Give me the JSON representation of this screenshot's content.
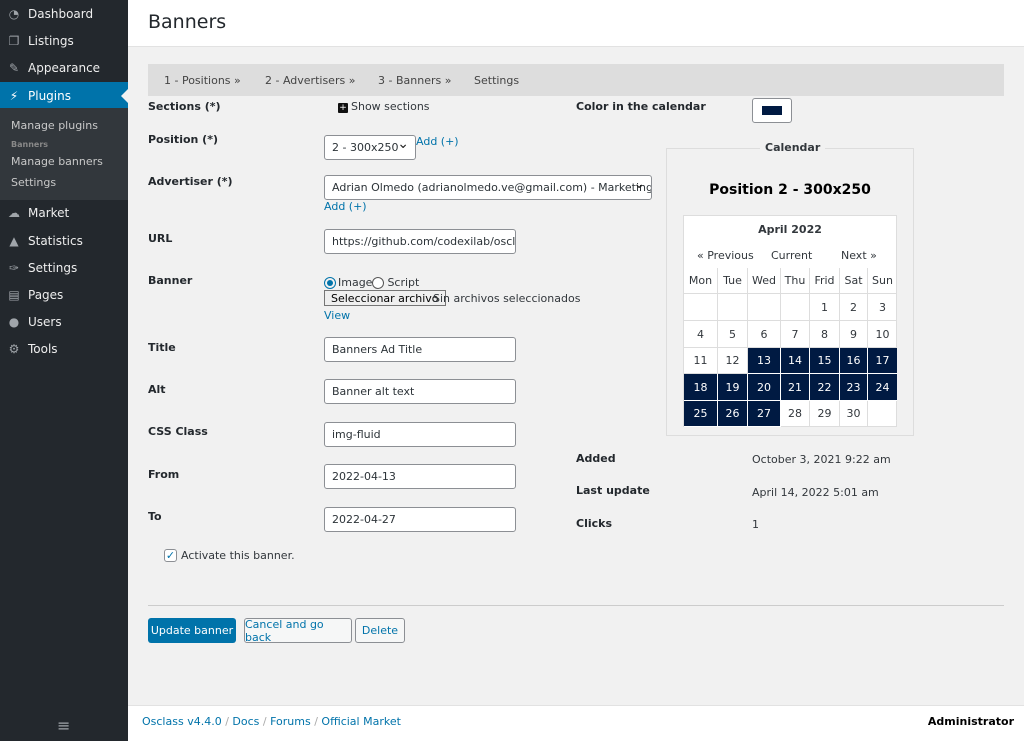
{
  "sidebar": {
    "items": [
      {
        "label": "Dashboard",
        "icon": "dashboard-icon",
        "glyph": "◔"
      },
      {
        "label": "Listings",
        "icon": "listings-icon",
        "glyph": "❐"
      },
      {
        "label": "Appearance",
        "icon": "brush-icon",
        "glyph": "✎"
      },
      {
        "label": "Plugins",
        "icon": "plug-icon",
        "glyph": "⚡"
      },
      {
        "label": "Market",
        "icon": "cloud-download-icon",
        "glyph": "☁"
      },
      {
        "label": "Statistics",
        "icon": "chart-icon",
        "glyph": "▲"
      },
      {
        "label": "Settings",
        "icon": "wrench-icon",
        "glyph": "✑"
      },
      {
        "label": "Pages",
        "icon": "page-icon",
        "glyph": "▤"
      },
      {
        "label": "Users",
        "icon": "user-icon",
        "glyph": "●"
      },
      {
        "label": "Tools",
        "icon": "gears-icon",
        "glyph": "⚙"
      }
    ],
    "submenu": {
      "manage_plugins": "Manage plugins",
      "group": "Banners",
      "manage_banners": "Manage banners",
      "settings": "Settings"
    },
    "collapse_glyph": "≡"
  },
  "header": {
    "title": "Banners"
  },
  "tabs": [
    "1 - Positions »",
    "2 - Advertisers »",
    "3 - Banners »",
    "Settings"
  ],
  "form": {
    "sections_label": "Sections (*)",
    "show_sections": "Show sections",
    "position_label": "Position (*)",
    "position_value": "2 - 300x250",
    "add": "Add (+)",
    "advertiser_label": "Advertiser (*)",
    "advertiser_value": "Adrian Olmedo (adrianolmedo.ve@gmail.com) - Marketing",
    "url_label": "URL",
    "url_value": "https://github.com/codexilab/oscla",
    "banner_label": "Banner",
    "radio_image": "Image",
    "radio_script": "Script",
    "file_button": "Seleccionar archivo",
    "file_status": "Sin archivos seleccionados",
    "view": "View",
    "title_label": "Title",
    "title_value": "Banners Ad Title",
    "alt_label": "Alt",
    "alt_value": "Banner alt text",
    "css_label": "CSS Class",
    "css_value": "img-fluid",
    "from_label": "From",
    "from_value": "2022-04-13",
    "to_label": "To",
    "to_value": "2022-04-27",
    "activate_label": "Activate this banner.",
    "activate_checked": true
  },
  "right": {
    "color_label": "Color in the calendar",
    "color_value": "#001a42",
    "added_label": "Added",
    "added_value": "October 3, 2021 9:22 am",
    "updated_label": "Last update",
    "updated_value": "April 14, 2022 5:01 am",
    "clicks_label": "Clicks",
    "clicks_value": "1"
  },
  "calendar": {
    "legend": "Calendar",
    "heading": "Position 2 - 300x250",
    "month": "April 2022",
    "prev": "« Previous",
    "current": "Current",
    "next": "Next »",
    "weekdays": [
      "Mon",
      "Tue",
      "Wed",
      "Thu",
      "Frid",
      "Sat",
      "Sun"
    ],
    "weeks": [
      [
        "",
        "",
        "",
        "",
        "1",
        "2",
        "3"
      ],
      [
        "4",
        "5",
        "6",
        "7",
        "8",
        "9",
        "10"
      ],
      [
        "11",
        "12",
        "13",
        "14",
        "15",
        "16",
        "17"
      ],
      [
        "18",
        "19",
        "20",
        "21",
        "22",
        "23",
        "24"
      ],
      [
        "25",
        "26",
        "27",
        "28",
        "29",
        "30",
        ""
      ]
    ],
    "highlighted": [
      "13",
      "14",
      "15",
      "16",
      "17",
      "18",
      "19",
      "20",
      "21",
      "22",
      "23",
      "24",
      "25",
      "26",
      "27"
    ],
    "highlight_color": "#001a42"
  },
  "buttons": {
    "update": "Update banner",
    "cancel": "Cancel and go back",
    "delete": "Delete"
  },
  "footer": {
    "links": [
      "Osclass v4.4.0",
      "Docs",
      "Forums",
      "Official Market"
    ],
    "user": "Administrator"
  }
}
